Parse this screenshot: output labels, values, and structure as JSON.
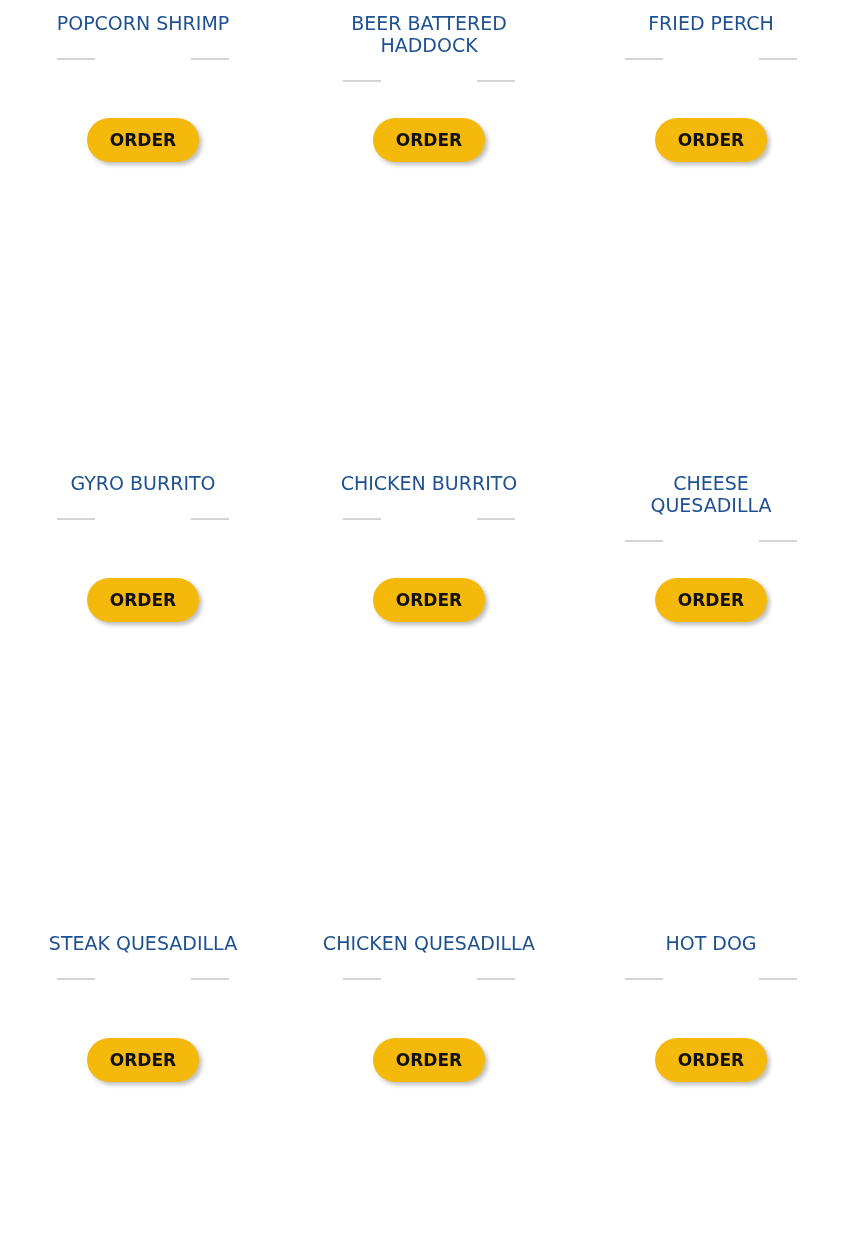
{
  "menu_items": [
    {
      "name": "POPCORN SHRIMP",
      "button": "ORDER"
    },
    {
      "name": "BEER BATTERED HADDOCK",
      "button": "ORDER"
    },
    {
      "name": "FRIED PERCH",
      "button": "ORDER"
    },
    {
      "name": "GYRO BURRITO",
      "button": "ORDER"
    },
    {
      "name": "CHICKEN BURRITO",
      "button": "ORDER"
    },
    {
      "name": "CHEESE QUESADILLA",
      "button": "ORDER"
    },
    {
      "name": "STEAK QUESADILLA",
      "button": "ORDER"
    },
    {
      "name": "CHICKEN QUESADILLA",
      "button": "ORDER"
    },
    {
      "name": "HOT DOG",
      "button": "ORDER"
    }
  ]
}
